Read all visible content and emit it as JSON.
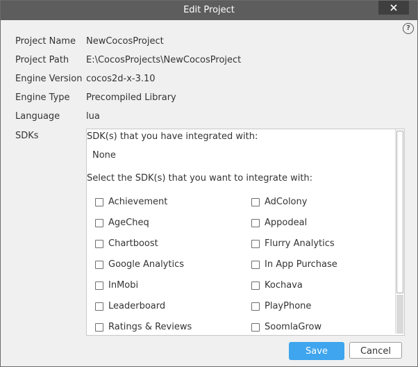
{
  "window": {
    "title": "Edit Project",
    "help_glyph": "?",
    "titlebar_color": "#5d5d5d"
  },
  "fields": {
    "project_name": {
      "label": "Project Name",
      "value": "NewCocosProject"
    },
    "project_path": {
      "label": "Project Path",
      "value": "E:\\CocosProjects\\NewCocosProject"
    },
    "engine_version": {
      "label": "Engine Version",
      "value": "cocos2d-x-3.10"
    },
    "engine_type": {
      "label": "Engine Type",
      "value": "Precompiled Library"
    },
    "language": {
      "label": "Language",
      "value": "lua"
    },
    "sdks": {
      "label": "SDKs"
    }
  },
  "sdk_panel": {
    "integrated_heading": "SDK(s) that you have integrated with:",
    "integrated_value": "None",
    "select_heading": "Select the SDK(s) that you want to integrate with:",
    "items": [
      {
        "label": "Achievement",
        "checked": false
      },
      {
        "label": "AdColony",
        "checked": false
      },
      {
        "label": "AgeCheq",
        "checked": false
      },
      {
        "label": "Appodeal",
        "checked": false
      },
      {
        "label": "Chartboost",
        "checked": false
      },
      {
        "label": "Flurry Analytics",
        "checked": false
      },
      {
        "label": "Google Analytics",
        "checked": false
      },
      {
        "label": "In App Purchase",
        "checked": false
      },
      {
        "label": "InMobi",
        "checked": false
      },
      {
        "label": "Kochava",
        "checked": false
      },
      {
        "label": "Leaderboard",
        "checked": false
      },
      {
        "label": "PlayPhone",
        "checked": false
      },
      {
        "label": "Ratings & Reviews",
        "checked": false
      },
      {
        "label": "SoomlaGrow",
        "checked": false
      }
    ]
  },
  "buttons": {
    "save_label": "Save",
    "cancel_label": "Cancel",
    "save_color": "#3ea5ee"
  }
}
